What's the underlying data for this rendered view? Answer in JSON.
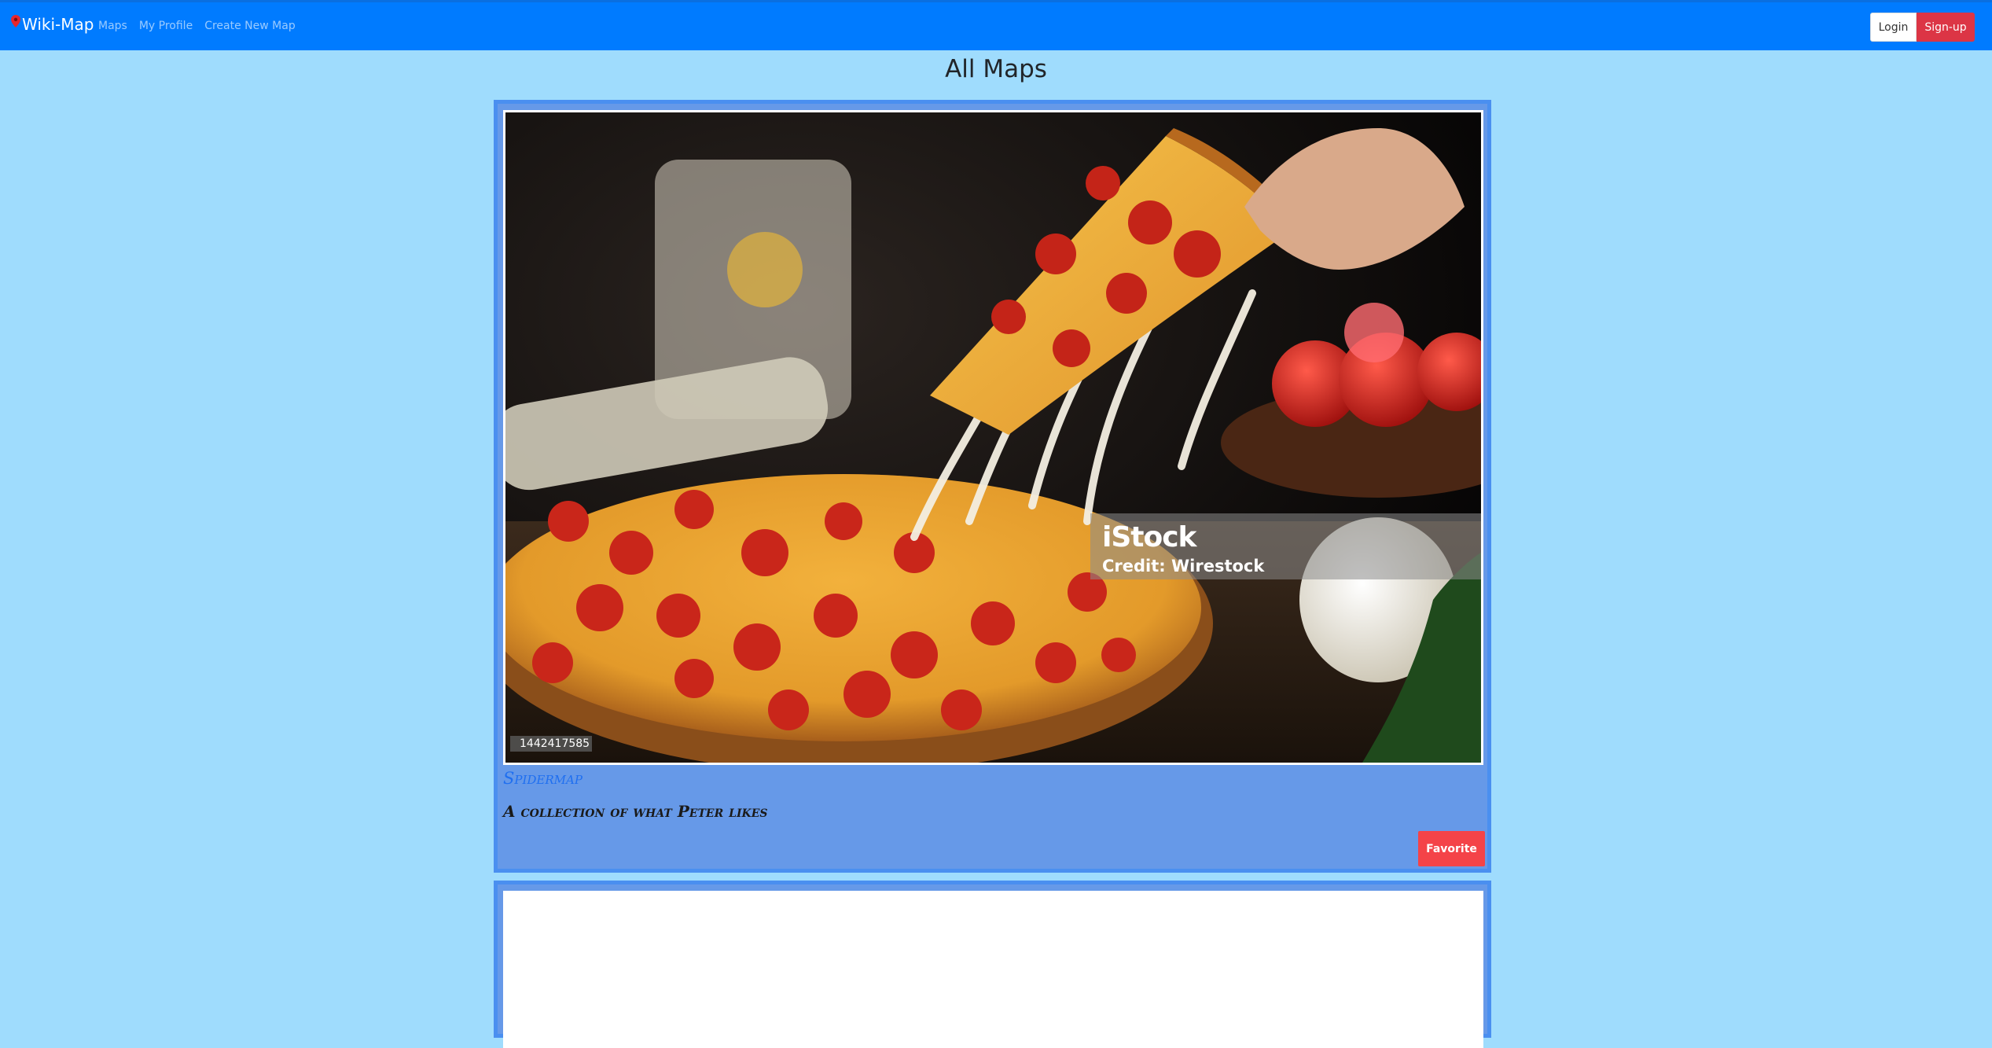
{
  "nav": {
    "brand": "Wiki-Map",
    "links": [
      "Maps",
      "My Profile",
      "Create New Map"
    ],
    "login": "Login",
    "signup": "Sign-up"
  },
  "page": {
    "title": "All Maps"
  },
  "maps": [
    {
      "name": "Spidermap",
      "description": "A collection of what Peter likes",
      "favorite_label": "Favorite",
      "image": {
        "watermark": "iStock",
        "credit": "Credit: Wirestock",
        "stock_id": "1442417585"
      }
    }
  ],
  "colors": {
    "navbar": "#007bff",
    "page_bg": "#9fdcfd",
    "card_bg": "#6699e8",
    "signup": "#dc3545",
    "favorite": "#f44348",
    "map_title": "#1f6ff0"
  },
  "icons": {
    "brand_icon": "map-pin-icon"
  }
}
